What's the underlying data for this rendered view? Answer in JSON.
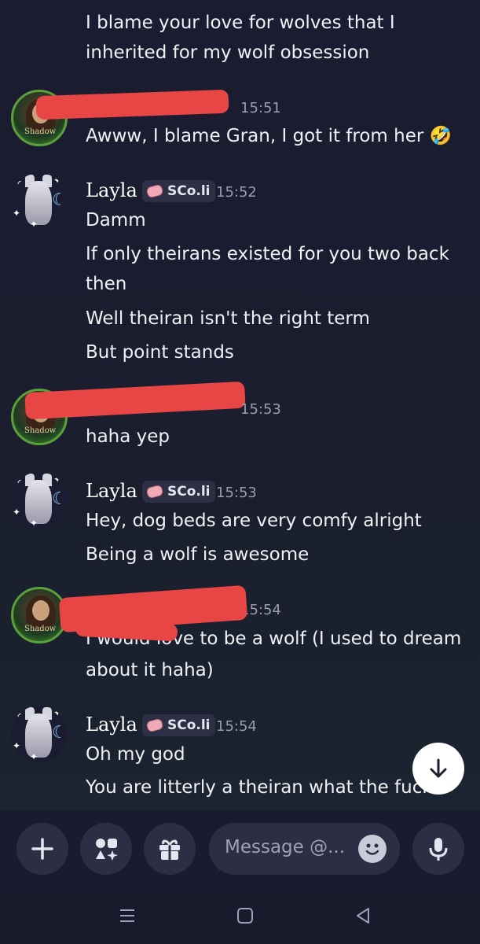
{
  "messages": {
    "m0": {
      "lines": [
        "I blame your love for wolves that I",
        "inherited for my wolf obsession"
      ]
    },
    "m1": {
      "time": "15:51",
      "lines": [
        "Awww, I blame Gran, I got it from her 🤣"
      ]
    },
    "m2": {
      "name": "Layla",
      "tag": "SCo.li",
      "time": "15:52",
      "lines": [
        "Damm",
        "If only theirans existed for you two back",
        "then",
        "Well theiran isn't the right term",
        "But point stands"
      ]
    },
    "m3": {
      "time": "15:53",
      "lines": [
        "haha yep"
      ]
    },
    "m4": {
      "name": "Layla",
      "tag": "SCo.li",
      "time": "15:53",
      "lines": [
        "Hey, dog beds are very comfy alright",
        "Being a wolf is awesome"
      ]
    },
    "m5": {
      "time": "15:54",
      "lines": [
        "I would love to be a wolf (I used to dream",
        "about it haha)"
      ]
    },
    "m6": {
      "name": "Layla",
      "tag": "SCo.li",
      "time": "15:54",
      "lines": [
        "Oh my god",
        "You are litterly a theiran what the fuck"
      ]
    }
  },
  "avatar_label": "Shadow",
  "composer": {
    "placeholder": "Message @..."
  },
  "icons": {
    "jump": "arrow-down-icon",
    "add": "plus-icon",
    "apps": "apps-icon",
    "gift": "gift-icon",
    "emoji": "emoji-icon",
    "mic": "microphone-icon",
    "nav": [
      "menu-lines-icon",
      "home-square-icon",
      "back-triangle-icon"
    ]
  },
  "colors": {
    "background": "#1b1c31",
    "redaction": "#e84545",
    "text": "#f0f1f5",
    "timestamp": "#9a9db0"
  }
}
